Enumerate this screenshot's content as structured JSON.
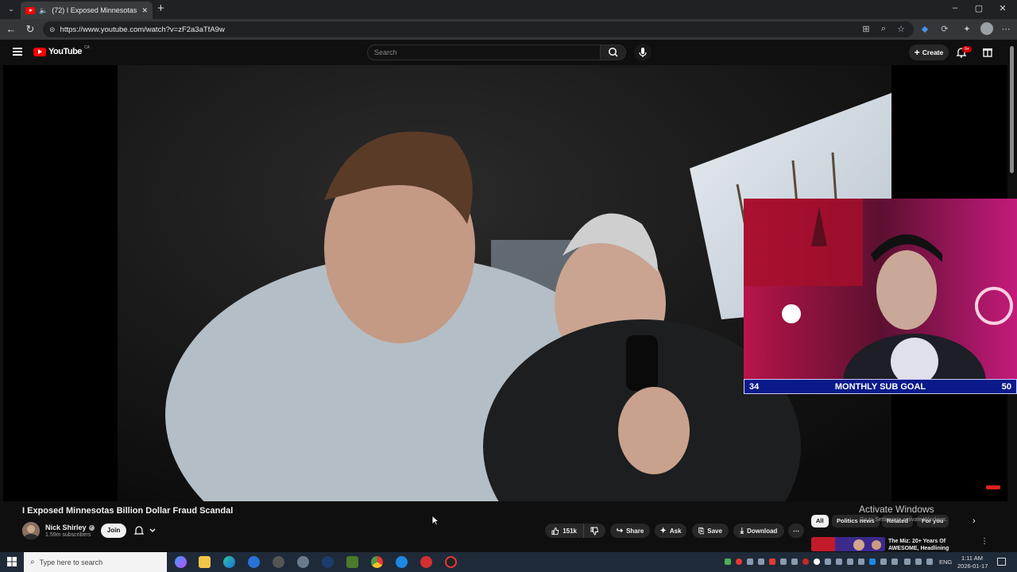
{
  "browser": {
    "tab": {
      "title": "(72) I Exposed Minnesotas B"
    },
    "url": "https://www.youtube.com/watch?v=zF2a3aTfA9w",
    "new_tab_label": "+",
    "window_controls": {
      "minimize": "–",
      "maximize": "▢",
      "close": "✕"
    }
  },
  "youtube": {
    "logo_text": "YouTube",
    "country_code": "CA",
    "search_placeholder": "Search",
    "create_label": "Create",
    "notifications_count": "9+"
  },
  "video": {
    "overlay": {
      "goal_current": "34",
      "goal_title": "MONTHLY SUB GOAL",
      "goal_target": "50"
    }
  },
  "details": {
    "title": "I Exposed Minnesotas Billion Dollar Fraud Scandal",
    "channel_name": "Nick Shirley",
    "subscribers": "1.59m subscribers",
    "join_label": "Join",
    "likes": "151k",
    "share_label": "Share",
    "ask_label": "Ask",
    "save_label": "Save",
    "download_label": "Download",
    "more_label": "⋯"
  },
  "recommendations": {
    "chips": [
      "All",
      "Politics news",
      "Related",
      "For you"
    ],
    "active_chip": "All",
    "first_item_title": "The Miz: 20+ Years Of AWESOME, Headlining"
  },
  "watermark": {
    "title": "Activate Windows",
    "subtitle": "Go to Settings to activate Windows."
  },
  "taskbar": {
    "search_placeholder": "Type here to search",
    "language": "ENG",
    "time": "1:11 AM",
    "date": "2026-01-17"
  },
  "colors": {
    "youtube_red": "#ff0000",
    "page_bg": "#0f0f0f",
    "goal_bar": "#0a1a8a"
  }
}
